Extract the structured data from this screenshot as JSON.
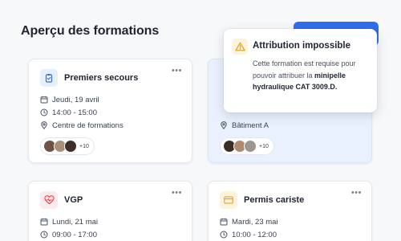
{
  "page": {
    "title": "Aperçu des formations"
  },
  "cards": [
    {
      "title": "Premiers secours",
      "icon": "clipboard-check-icon",
      "date": "Jeudi, 19 avril",
      "time": "14:00 - 15:00",
      "location": "Centre de formations",
      "participants_extra": "+10",
      "menu": "•••"
    },
    {
      "location": "Bâtiment A",
      "participants_extra": "+10",
      "menu": "•••"
    },
    {
      "title": "VGP",
      "icon": "heartbeat-icon",
      "date": "Lundi, 21 mai",
      "time": "09:00 - 17:00",
      "menu": "•••"
    },
    {
      "title": "Permis cariste",
      "icon": "id-card-icon",
      "date": "Mardi, 23 mai",
      "time": "10:00 - 12:00",
      "menu": "•••"
    }
  ],
  "popover": {
    "title": "Attribution impossible",
    "body_prefix": "Cette formation est requise pour pouvoir attribuer la ",
    "body_emphasis": "minipelle hydraulique CAT 3009.D."
  },
  "colors": {
    "accent": "#2f6fed",
    "warning": "#e0a21b",
    "danger": "#e5484d",
    "blocked_card": "#eaf1fe"
  }
}
